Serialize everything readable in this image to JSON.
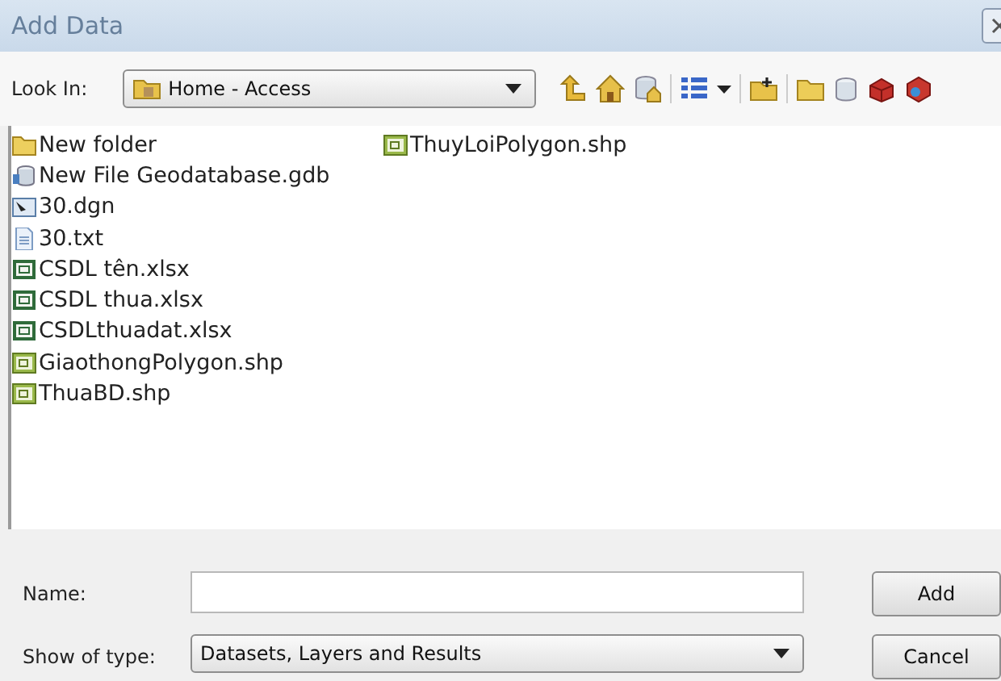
{
  "window": {
    "title": "Add Data"
  },
  "look_in": {
    "label": "Look In:",
    "value": "Home - Access"
  },
  "file_columns": [
    [
      {
        "name": "New folder",
        "kind": "folder"
      },
      {
        "name": "New File Geodatabase.gdb",
        "kind": "gdb"
      },
      {
        "name": "30.dgn",
        "kind": "dgn"
      },
      {
        "name": "30.txt",
        "kind": "txt"
      },
      {
        "name": "CSDL tên.xlsx",
        "kind": "xlsx"
      },
      {
        "name": "CSDL thua.xlsx",
        "kind": "xlsx"
      },
      {
        "name": "CSDLthuadat.xlsx",
        "kind": "xlsx"
      },
      {
        "name": "GiaothongPolygon.shp",
        "kind": "shp"
      },
      {
        "name": "ThuaBD.shp",
        "kind": "shp"
      }
    ],
    [
      {
        "name": "ThuyLoiPolygon.shp",
        "kind": "shp"
      }
    ]
  ],
  "name_field": {
    "label": "Name:"
  },
  "type_field": {
    "label": "Show of type:",
    "value": "Datasets, Layers and Results"
  },
  "buttons": [
    "Add",
    "Cancel"
  ]
}
